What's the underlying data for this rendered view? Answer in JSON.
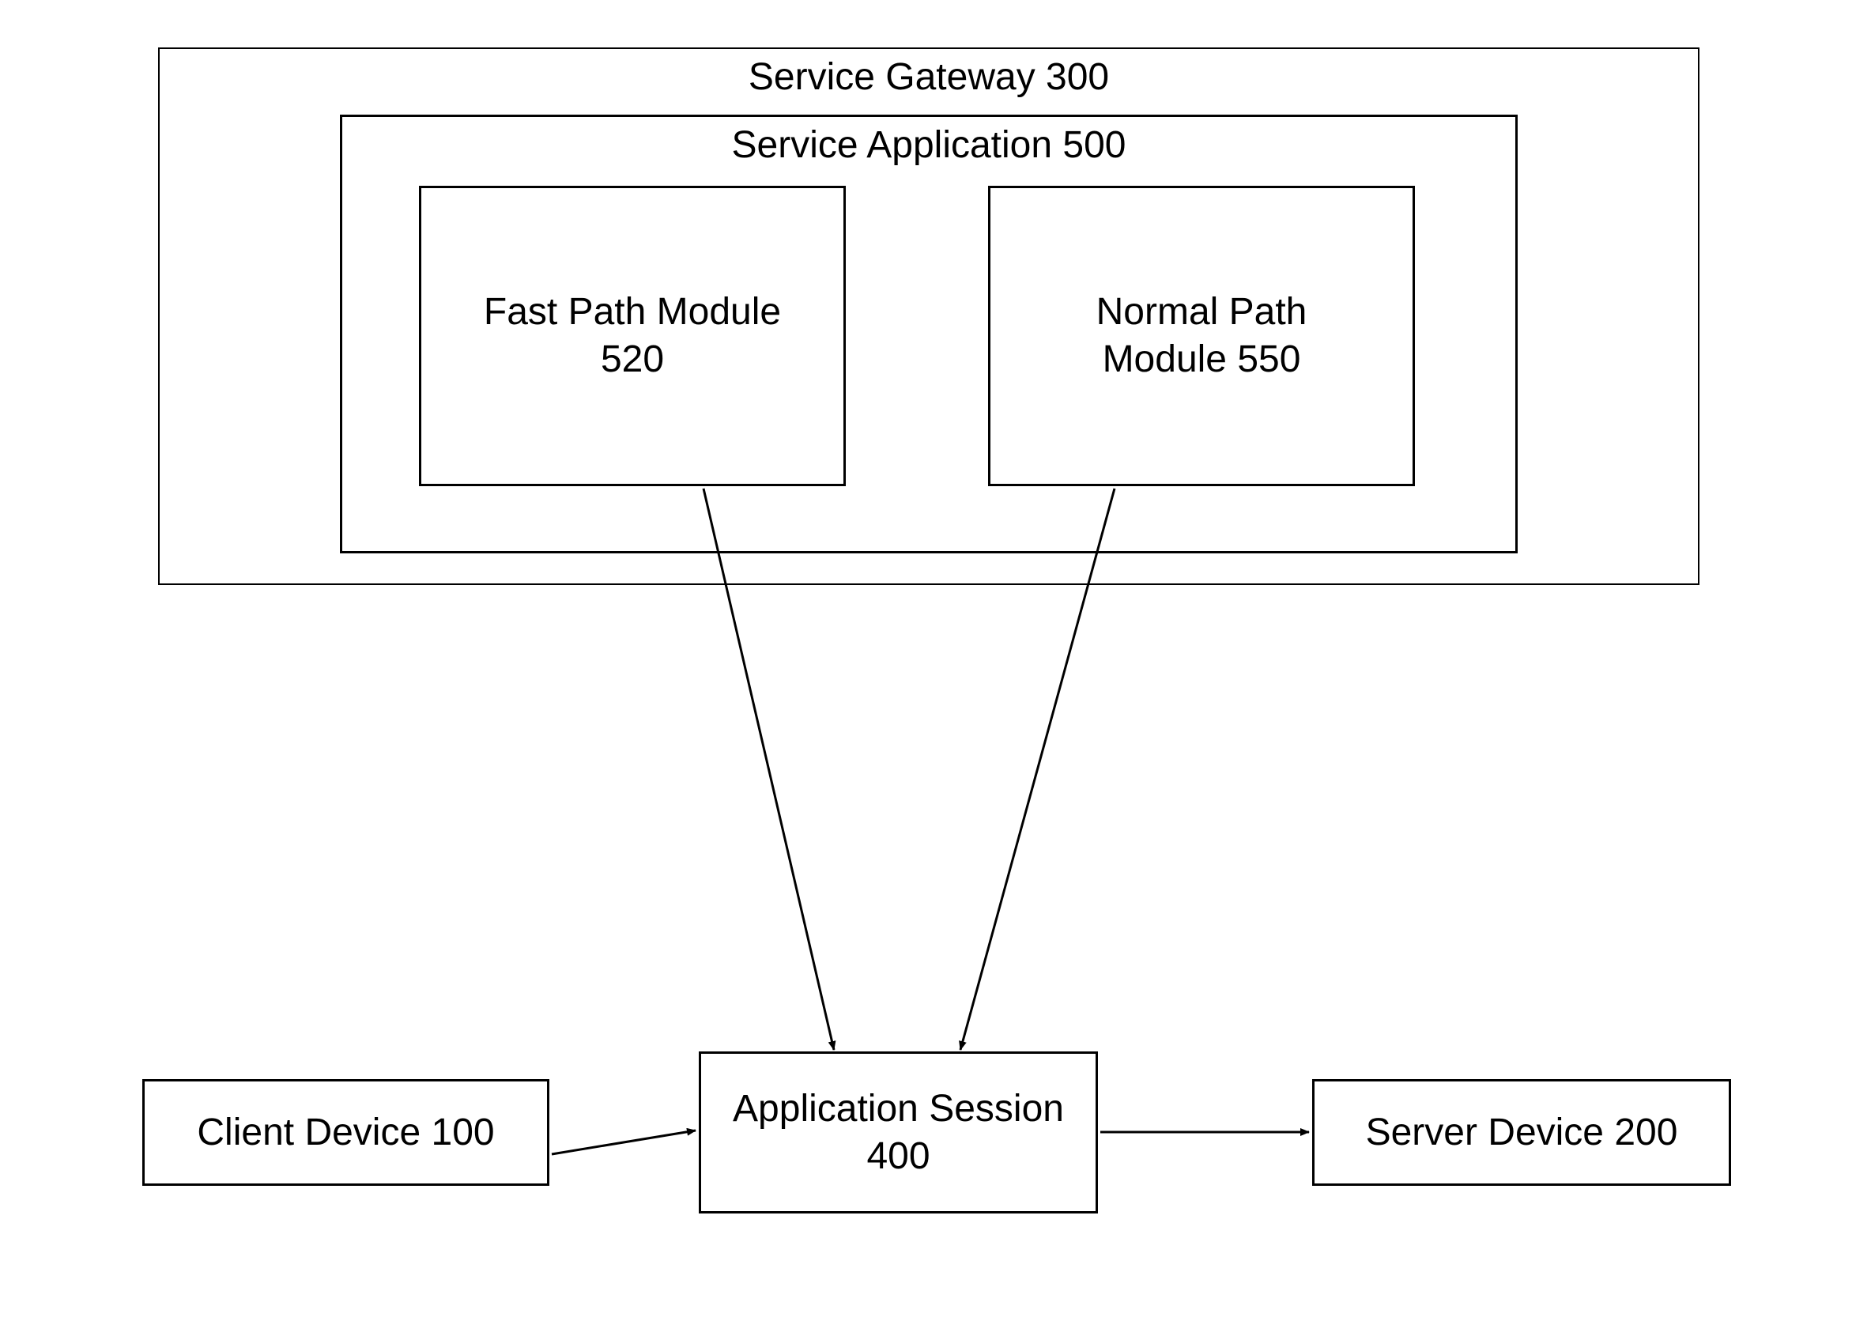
{
  "gateway": {
    "title": "Service Gateway 300",
    "application": {
      "title": "Service Application 500",
      "fast_path": {
        "line1": "Fast Path Module",
        "line2": "520"
      },
      "normal_path": {
        "line1": "Normal Path",
        "line2": "Module 550"
      }
    }
  },
  "client": {
    "label": "Client Device 100"
  },
  "session": {
    "line1": "Application Session",
    "line2": "400"
  },
  "server": {
    "label": "Server Device 200"
  }
}
